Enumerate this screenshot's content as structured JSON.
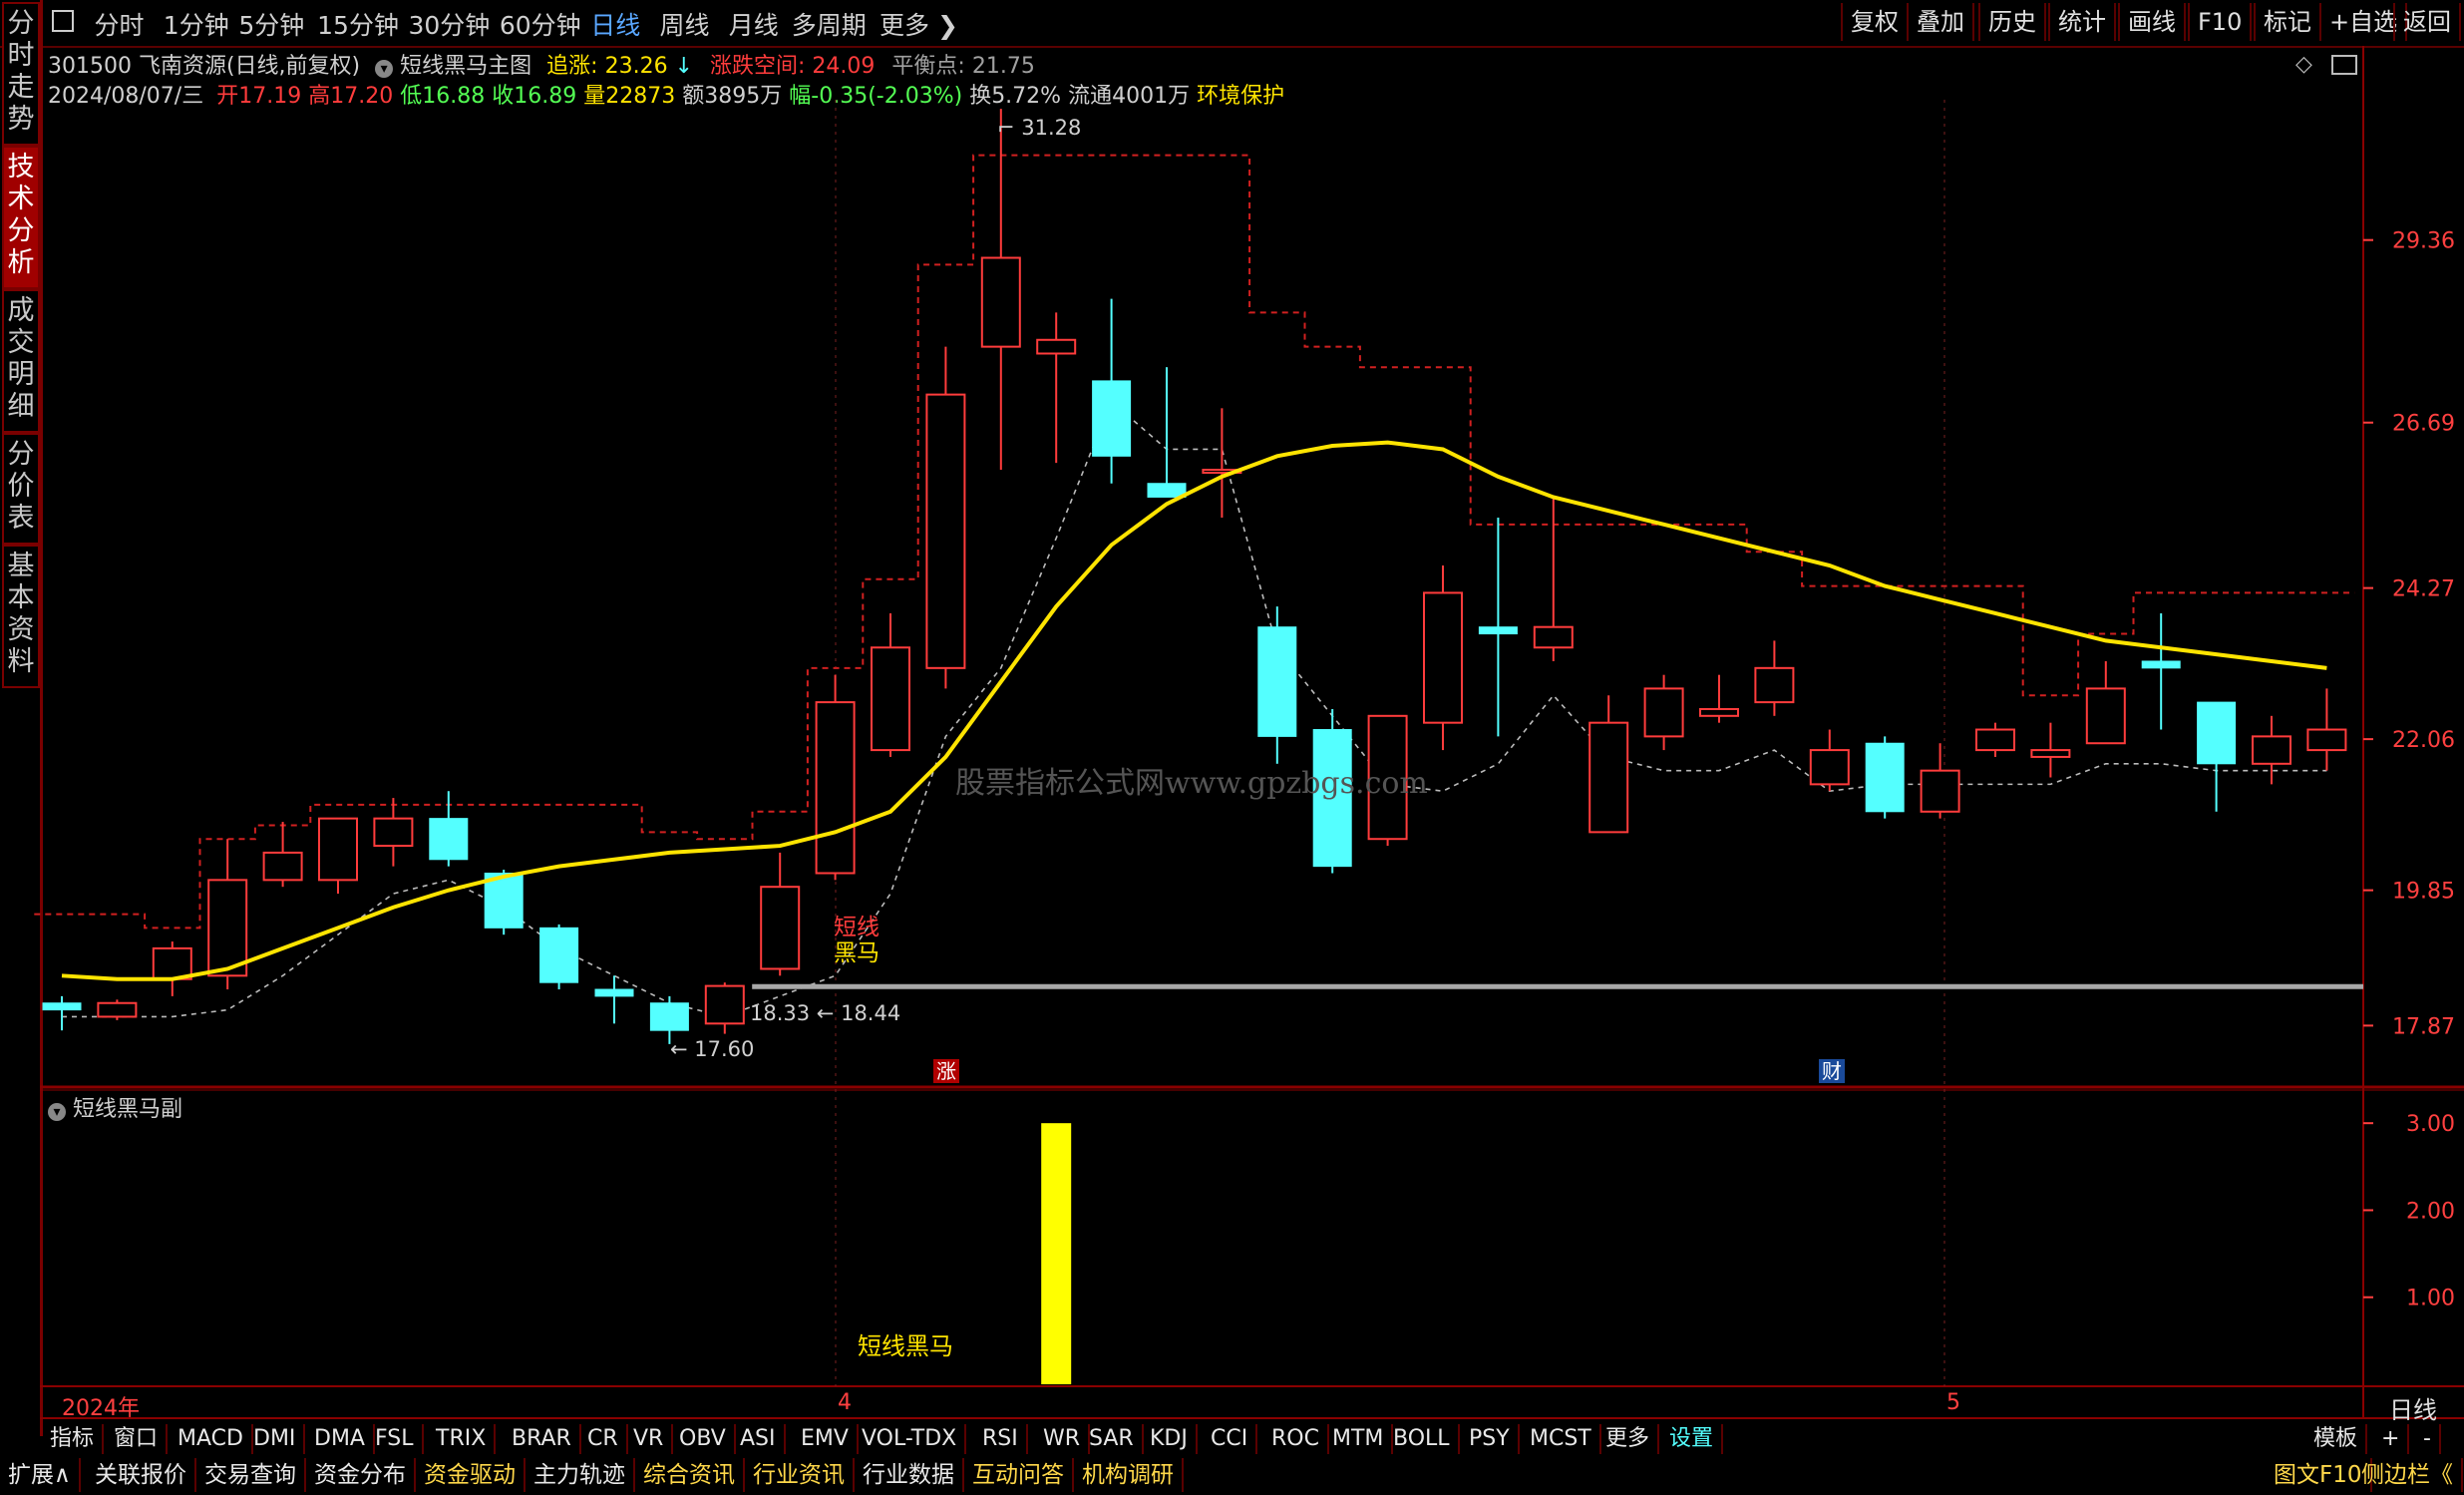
{
  "top_nav": {
    "periods": [
      "分时",
      "1分钟",
      "5分钟",
      "15分钟",
      "30分钟",
      "60分钟",
      "日线",
      "周线",
      "月线",
      "多周期",
      "更多"
    ],
    "active": "日线",
    "right_buttons": [
      "复权",
      "叠加",
      "历史",
      "统计",
      "画线",
      "F10",
      "标记",
      "+自选",
      "返回"
    ]
  },
  "left_tabs": [
    "分时走势",
    "技术分析",
    "成交明细",
    "分价表",
    "基本资料"
  ],
  "left_tab_active": "技术分析",
  "header": {
    "stock": "301500 飞南资源(日线,前复权)",
    "indicator": "短线黑马主图",
    "zhuizhang_label": "追涨:",
    "zhuizhang_value": "23.26",
    "zhangdie_label": "涨跌空间:",
    "zhangdie_value": "24.09",
    "pingheng_label": "平衡点:",
    "pingheng_value": "21.75",
    "date": "2024/08/07/三",
    "open_label": "开",
    "open": "17.19",
    "high_label": "高",
    "high": "17.20",
    "low_label": "低",
    "low": "16.88",
    "close_label": "收",
    "close": "16.89",
    "vol_label": "量",
    "vol": "22873",
    "amt_label": "额",
    "amt": "3895万",
    "chg_label": "幅",
    "chg": "-0.35(-2.03%)",
    "turnover": "换5.72%",
    "float": "流通4001万",
    "tag": "环境保护"
  },
  "watermark": "股票指标公式网www.gpzbgs.com",
  "annotations": {
    "high_label": "31.28",
    "low_label": "17.60",
    "mid_label_a": "18.33",
    "mid_label_b": "18.44",
    "signal_red": "短线",
    "signal_yellow": "黑马",
    "event_zhang": "涨",
    "event_cai": "财"
  },
  "sub_panel": {
    "title": "短线黑马副",
    "bar_label": "短线黑马",
    "y_ticks": [
      "3.00",
      "2.00",
      "1.00"
    ]
  },
  "time_axis": {
    "year": "2024年",
    "m4": "4",
    "m5": "5",
    "mode": "日线"
  },
  "chart_data": {
    "type": "candlestick",
    "price_axis_ticks": [
      "29.36",
      "26.69",
      "24.27",
      "22.06",
      "19.85",
      "17.87"
    ],
    "candles": [
      {
        "o": 18.2,
        "h": 18.3,
        "l": 17.8,
        "c": 18.1
      },
      {
        "o": 18.0,
        "h": 18.25,
        "l": 17.95,
        "c": 18.2
      },
      {
        "o": 18.55,
        "h": 19.1,
        "l": 18.3,
        "c": 19.0
      },
      {
        "o": 18.6,
        "h": 20.6,
        "l": 18.4,
        "c": 20.0
      },
      {
        "o": 20.0,
        "h": 20.85,
        "l": 19.9,
        "c": 20.4
      },
      {
        "o": 20.0,
        "h": 20.9,
        "l": 19.8,
        "c": 20.9
      },
      {
        "o": 20.5,
        "h": 21.2,
        "l": 20.2,
        "c": 20.9
      },
      {
        "o": 20.9,
        "h": 21.3,
        "l": 20.2,
        "c": 20.3
      },
      {
        "o": 20.1,
        "h": 20.15,
        "l": 19.2,
        "c": 19.3
      },
      {
        "o": 19.3,
        "h": 19.35,
        "l": 18.4,
        "c": 18.5
      },
      {
        "o": 18.4,
        "h": 18.6,
        "l": 17.9,
        "c": 18.3
      },
      {
        "o": 18.2,
        "h": 18.3,
        "l": 17.6,
        "c": 17.8
      },
      {
        "o": 17.9,
        "h": 18.5,
        "l": 17.75,
        "c": 18.45
      },
      {
        "o": 18.7,
        "h": 20.4,
        "l": 18.6,
        "c": 19.9
      },
      {
        "o": 20.1,
        "h": 23.0,
        "l": 20.0,
        "c": 22.6
      },
      {
        "o": 21.9,
        "h": 23.9,
        "l": 21.8,
        "c": 23.4
      },
      {
        "o": 23.1,
        "h": 27.8,
        "l": 22.8,
        "c": 27.1
      },
      {
        "o": 27.8,
        "h": 31.28,
        "l": 26.0,
        "c": 29.1
      },
      {
        "o": 27.7,
        "h": 28.3,
        "l": 26.1,
        "c": 27.9
      },
      {
        "o": 27.3,
        "h": 28.5,
        "l": 25.8,
        "c": 26.2
      },
      {
        "o": 25.8,
        "h": 27.5,
        "l": 25.6,
        "c": 25.6
      },
      {
        "o": 26.0,
        "h": 26.9,
        "l": 25.3,
        "c": 26.0
      },
      {
        "o": 23.7,
        "h": 24.0,
        "l": 21.7,
        "c": 22.1
      },
      {
        "o": 22.2,
        "h": 22.5,
        "l": 20.1,
        "c": 20.2
      },
      {
        "o": 20.6,
        "h": 22.4,
        "l": 20.5,
        "c": 22.4
      },
      {
        "o": 22.3,
        "h": 24.6,
        "l": 21.9,
        "c": 24.2
      },
      {
        "o": 23.7,
        "h": 25.3,
        "l": 22.1,
        "c": 23.6
      },
      {
        "o": 23.4,
        "h": 25.6,
        "l": 23.2,
        "c": 23.7
      },
      {
        "o": 20.7,
        "h": 22.7,
        "l": 20.7,
        "c": 22.3
      },
      {
        "o": 22.1,
        "h": 23.0,
        "l": 21.9,
        "c": 22.8
      },
      {
        "o": 22.4,
        "h": 23.0,
        "l": 22.3,
        "c": 22.5
      },
      {
        "o": 22.6,
        "h": 23.5,
        "l": 22.4,
        "c": 23.1
      },
      {
        "o": 21.4,
        "h": 22.2,
        "l": 21.3,
        "c": 21.9
      },
      {
        "o": 22.0,
        "h": 22.1,
        "l": 20.9,
        "c": 21.0
      },
      {
        "o": 21.0,
        "h": 22.0,
        "l": 20.9,
        "c": 21.6
      },
      {
        "o": 21.9,
        "h": 22.3,
        "l": 21.8,
        "c": 22.2
      },
      {
        "o": 21.8,
        "h": 22.3,
        "l": 21.5,
        "c": 21.9
      },
      {
        "o": 22.0,
        "h": 23.2,
        "l": 22.0,
        "c": 22.8
      },
      {
        "o": 23.2,
        "h": 23.9,
        "l": 22.2,
        "c": 23.1
      },
      {
        "o": 22.6,
        "h": 22.6,
        "l": 21.0,
        "c": 21.7
      },
      {
        "o": 21.7,
        "h": 22.4,
        "l": 21.4,
        "c": 22.1
      },
      {
        "o": 21.9,
        "h": 22.8,
        "l": 21.6,
        "c": 22.2
      }
    ],
    "ma_yellow": [
      18.6,
      18.55,
      18.55,
      18.7,
      19.0,
      19.3,
      19.6,
      19.85,
      20.05,
      20.2,
      20.3,
      20.4,
      20.45,
      20.5,
      20.7,
      21.0,
      21.8,
      22.9,
      24.0,
      24.9,
      25.5,
      25.9,
      26.2,
      26.35,
      26.4,
      26.3,
      25.9,
      25.6,
      25.4,
      25.2,
      25.0,
      24.8,
      24.6,
      24.3,
      24.1,
      23.9,
      23.7,
      23.5,
      23.4,
      23.3,
      23.2,
      23.1
    ],
    "upper_red_dashed": [
      19.5,
      19.5,
      19.3,
      20.6,
      20.8,
      21.1,
      21.1,
      21.1,
      21.1,
      21.1,
      21.1,
      20.7,
      20.6,
      21.0,
      23.1,
      24.4,
      29.0,
      30.6,
      30.6,
      30.6,
      30.6,
      30.6,
      28.3,
      27.8,
      27.5,
      27.5,
      25.2,
      25.2,
      25.2,
      25.2,
      25.2,
      24.8,
      24.3,
      24.3,
      24.3,
      24.3,
      22.7,
      23.6,
      24.2,
      24.2,
      24.2,
      24.2
    ],
    "lower_gray_dashed": [
      18.0,
      18.0,
      18.0,
      18.1,
      18.6,
      19.2,
      19.8,
      20.0,
      19.6,
      19.0,
      18.6,
      18.2,
      18.0,
      18.3,
      18.6,
      19.8,
      22.1,
      23.1,
      25.0,
      27.0,
      26.3,
      26.3,
      23.4,
      22.4,
      21.4,
      21.3,
      21.7,
      22.7,
      21.8,
      21.6,
      21.6,
      21.9,
      21.3,
      21.4,
      21.4,
      21.4,
      21.4,
      21.7,
      21.7,
      21.6,
      21.6,
      21.6
    ],
    "support_line": 18.44,
    "signal_index": 13,
    "sub_bar_value": 3.0
  },
  "indicator_bar": [
    "指标",
    "窗口",
    "MACD",
    "DMI",
    "DMA",
    "FSL",
    "TRIX",
    "BRAR",
    "CR",
    "VR",
    "OBV",
    "ASI",
    "EMV",
    "VOL-TDX",
    "RSI",
    "WR",
    "SAR",
    "KDJ",
    "CCI",
    "ROC",
    "MTM",
    "BOLL",
    "PSY",
    "MCST",
    "更多",
    "设置"
  ],
  "indicator_bar_right": [
    "模板",
    "+",
    "-"
  ],
  "bottom_bar": [
    "扩展∧",
    "关联报价",
    "交易查询",
    "资金分布",
    "资金驱动",
    "主力轨迹",
    "综合资讯",
    "行业资讯",
    "行业数据",
    "互动问答",
    "机构调研"
  ],
  "bottom_bar_highlight": [
    "资金驱动",
    "综合资讯",
    "行业资讯",
    "互动问答",
    "机构调研"
  ],
  "bottom_bar_right": [
    "图文F10",
    "侧边栏《"
  ],
  "colors": {
    "up": "#ff3c3c",
    "down": "#54ffff",
    "ma": "#ffe400",
    "bg": "#000000"
  }
}
